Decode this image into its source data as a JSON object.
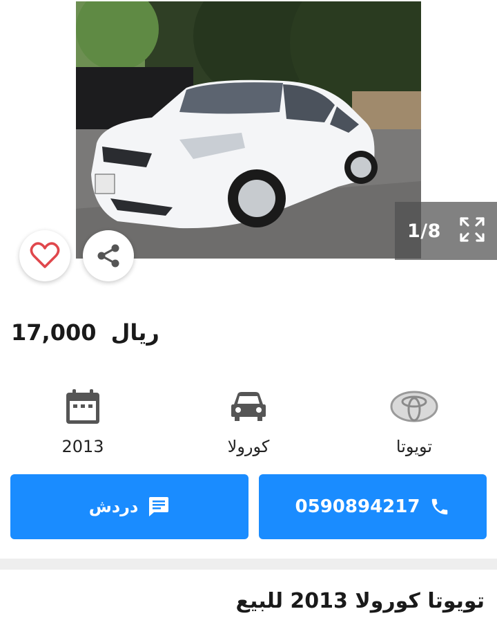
{
  "gallery": {
    "counter": "1/8",
    "current_index": 1,
    "total_images": 8,
    "icons": {
      "prev": "chevron-left-icon",
      "next": "chevron-right-icon",
      "fullscreen": "fullscreen-icon",
      "favorite": "heart-icon",
      "share": "share-icon"
    }
  },
  "listing": {
    "price_value": "17,000",
    "price_currency": "ريال",
    "title": "تويوتا كورولا 2013 للبيع"
  },
  "specs": {
    "year": "2013",
    "model": "كورولا",
    "make": "تويوتا"
  },
  "actions": {
    "chat_label": "دردش",
    "phone_label": "0590894217"
  },
  "colors": {
    "accent": "#1a8cff",
    "favorite": "#e0474c",
    "icon_gray": "#555555"
  }
}
